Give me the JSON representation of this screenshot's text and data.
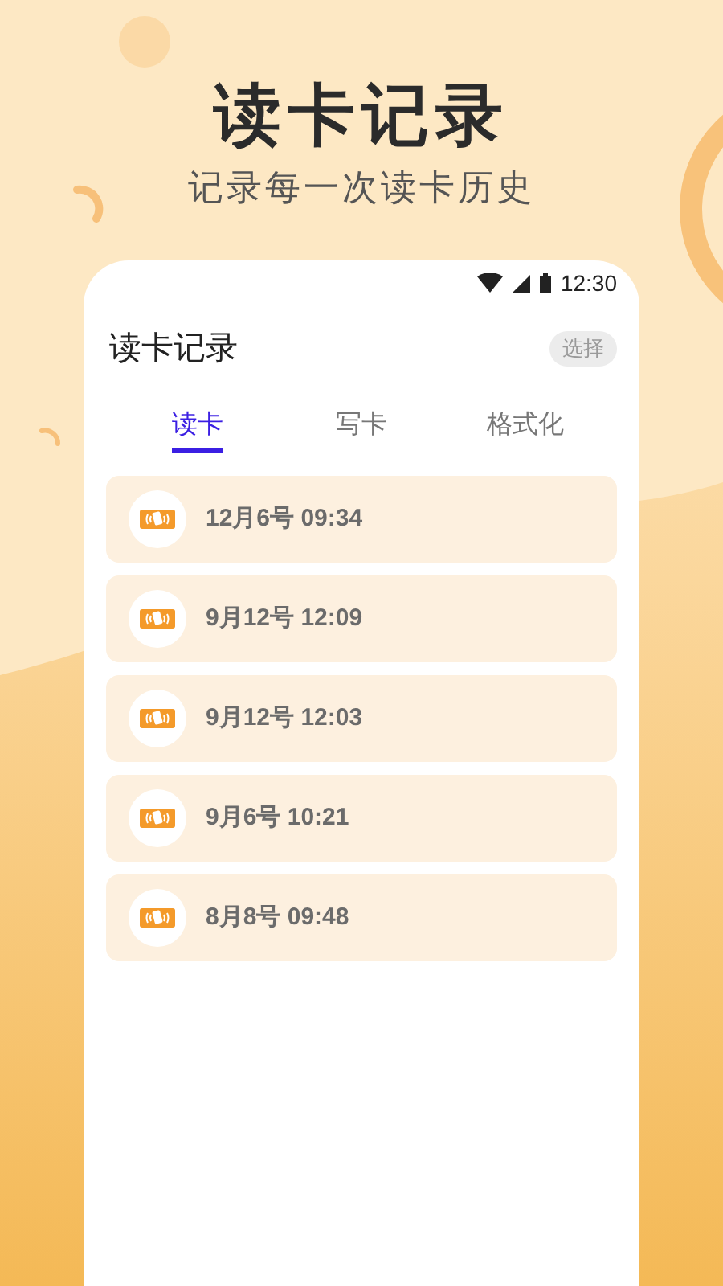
{
  "headline": "读卡记录",
  "subtitle": "记录每一次读卡历史",
  "phone": {
    "status_bar": {
      "time": "12:30"
    },
    "title": "读卡记录",
    "select_button": "选择",
    "tabs": [
      {
        "label": "读卡",
        "selected": true
      },
      {
        "label": "写卡",
        "selected": false
      },
      {
        "label": "格式化",
        "selected": false
      }
    ],
    "records": [
      {
        "label": "12月6号 09:34"
      },
      {
        "label": "9月12号 12:09"
      },
      {
        "label": "9月12号 12:03"
      },
      {
        "label": "9月6号 10:21"
      },
      {
        "label": "8月8号 09:48"
      }
    ]
  }
}
